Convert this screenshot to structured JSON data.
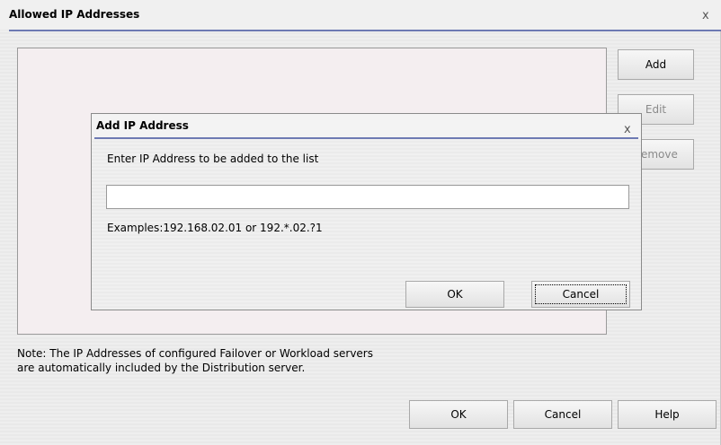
{
  "main_dialog": {
    "title": "Allowed IP Addresses",
    "close_glyph": "x",
    "ip_list_items": [],
    "buttons": {
      "add": "Add",
      "edit": "Edit",
      "remove": "Remove"
    },
    "note_line1": "Note: The IP Addresses of configured Failover or Workload servers",
    "note_line2": "are automatically included by the Distribution server.",
    "footer": {
      "ok": "OK",
      "cancel": "Cancel",
      "help": "Help"
    }
  },
  "sub_dialog": {
    "title": "Add IP Address",
    "close_glyph": "x",
    "prompt": "Enter IP Address to be added to the list",
    "ip_input_value": "",
    "examples": "Examples:192.168.02.01 or 192.*.02.?1",
    "buttons": {
      "ok": "OK",
      "cancel": "Cancel"
    }
  },
  "colors": {
    "title_rule": "#6d7ab3",
    "list_background": "#f4eef0",
    "disabled_text": "#8a8a8a"
  }
}
